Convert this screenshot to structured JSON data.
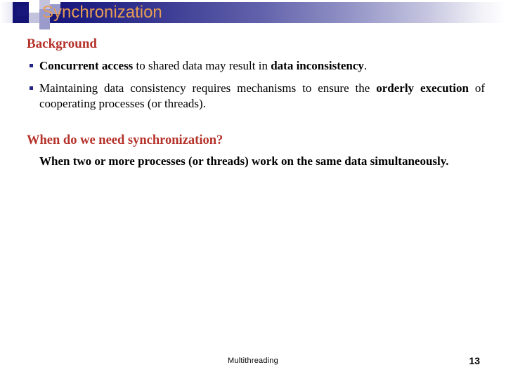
{
  "slide": {
    "title": "Synchronization",
    "title_color": "#e59b55",
    "banner_gradient_from": "#131375",
    "banner_gradient_to": "#ffffff",
    "heading_color": "#b5322a",
    "bullet_color": "#242484"
  },
  "body": {
    "heading_background": "Background",
    "bullets": [
      {
        "marker": "square-bullet",
        "parts": [
          {
            "text": "Concurrent access",
            "bold": true
          },
          {
            "text": " to shared data may result in ",
            "bold": false
          },
          {
            "text": "data inconsistency",
            "bold": true
          },
          {
            "text": ".",
            "bold": false
          }
        ]
      },
      {
        "marker": "square-bullet",
        "parts": [
          {
            "text": "Maintaining data consistency requires mechanisms to ensure the ",
            "bold": false
          },
          {
            "text": "orderly execution",
            "bold": true
          },
          {
            "text": " of cooperating processes (or threads).",
            "bold": false
          }
        ]
      }
    ],
    "heading_when": "When do we need synchronization?",
    "answer_paragraph": "When two or more processes (or threads) work on the same data simultaneously."
  },
  "footer": {
    "label": "Multithreading",
    "page_number": "13"
  }
}
